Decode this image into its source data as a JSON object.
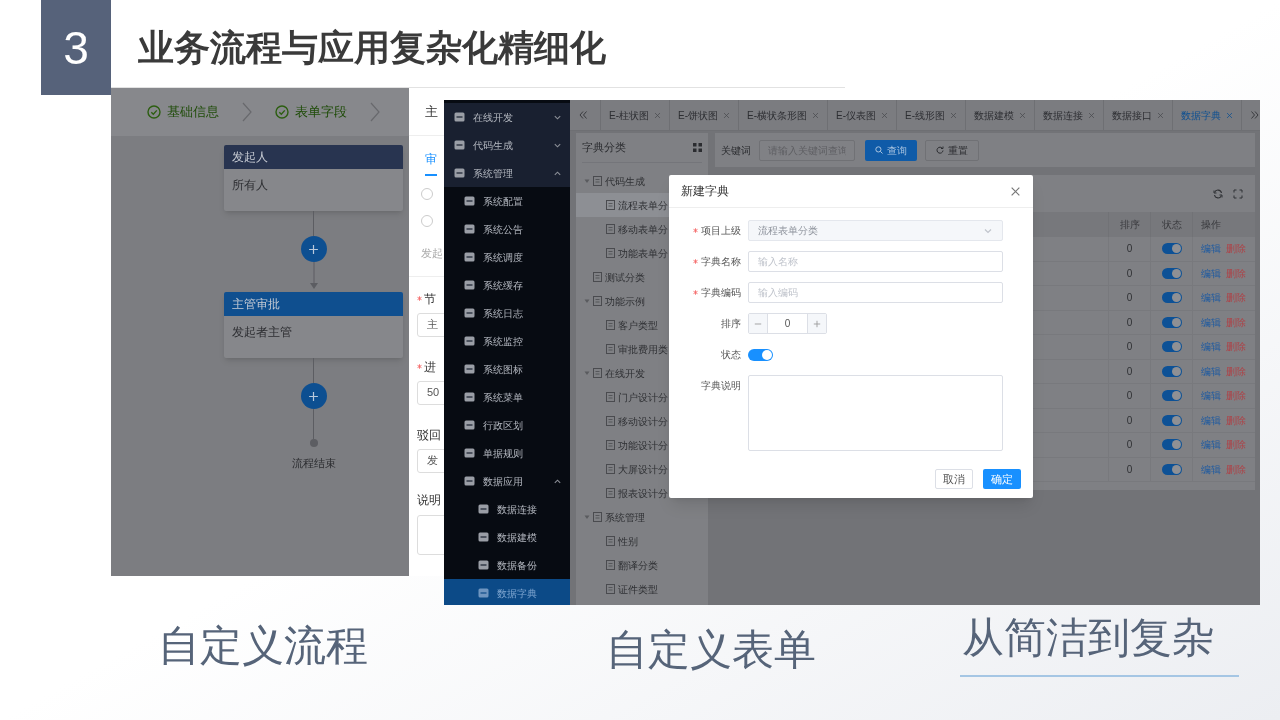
{
  "slide": {
    "number": "3",
    "title": "业务流程与应用复杂化精细化"
  },
  "flow_screenshot": {
    "steps": [
      {
        "label": "基础信息",
        "done": true
      },
      {
        "label": "表单字段",
        "done": true
      }
    ],
    "nodes": [
      {
        "kind": "start",
        "header": "发起人",
        "body": "所有人"
      },
      {
        "kind": "approval",
        "header": "主管审批",
        "body": "发起者主管"
      }
    ],
    "end_label": "流程结束"
  },
  "settings_panel": {
    "header": "主",
    "tab": {
      "label": "审",
      "selected": true
    },
    "radios": [
      {
        "selected": false
      },
      {
        "selected": false
      }
    ],
    "note": "发起",
    "fields": [
      {
        "label": "节",
        "required": true,
        "value": "主"
      },
      {
        "label": "进",
        "required": true,
        "value": "50"
      },
      {
        "label": "驳回",
        "required": false,
        "value": "发"
      }
    ],
    "description_label": "说明"
  },
  "app_screenshot": {
    "sidebar": [
      {
        "label": "在线开发",
        "expanded": false,
        "selected": false
      },
      {
        "label": "代码生成",
        "expanded": false,
        "selected": false
      },
      {
        "label": "系统管理",
        "expanded": true,
        "selected": false,
        "children": [
          {
            "label": "系统配置",
            "selected": false
          },
          {
            "label": "系统公告",
            "selected": false
          },
          {
            "label": "系统调度",
            "selected": false
          },
          {
            "label": "系统缓存",
            "selected": false
          },
          {
            "label": "系统日志",
            "selected": false
          },
          {
            "label": "系统监控",
            "selected": false
          },
          {
            "label": "系统图标",
            "selected": false
          },
          {
            "label": "系统菜单",
            "selected": false
          },
          {
            "label": "行政区划",
            "selected": false
          },
          {
            "label": "单据规则",
            "selected": false
          },
          {
            "label": "数据应用",
            "expanded": true,
            "selected": false,
            "children": [
              {
                "label": "数据连接",
                "selected": false
              },
              {
                "label": "数据建模",
                "selected": false
              },
              {
                "label": "数据备份",
                "selected": false
              },
              {
                "label": "数据字典",
                "selected": true
              }
            ]
          }
        ]
      }
    ],
    "tabs": [
      {
        "label": "E-柱状图",
        "selected": false
      },
      {
        "label": "E-饼状图",
        "selected": false
      },
      {
        "label": "E-横状条形图",
        "selected": false
      },
      {
        "label": "E-仪表图",
        "selected": false
      },
      {
        "label": "E-线形图",
        "selected": false
      },
      {
        "label": "数据建模",
        "selected": false
      },
      {
        "label": "数据连接",
        "selected": false
      },
      {
        "label": "数据接口",
        "selected": false
      },
      {
        "label": "数据字典",
        "selected": true
      }
    ],
    "tree": {
      "title": "字典分类",
      "items": [
        {
          "label": "代码生成",
          "expanded": true,
          "selected": false,
          "children": [
            {
              "label": "流程表单分",
              "selected": true
            },
            {
              "label": "移动表单分",
              "selected": false
            },
            {
              "label": "功能表单分",
              "selected": false
            }
          ]
        },
        {
          "label": "测试分类",
          "selected": false
        },
        {
          "label": "功能示例",
          "expanded": true,
          "selected": false,
          "children": [
            {
              "label": "客户类型",
              "selected": false
            },
            {
              "label": "审批费用类",
              "selected": false
            }
          ]
        },
        {
          "label": "在线开发",
          "expanded": true,
          "selected": false,
          "children": [
            {
              "label": "门户设计分",
              "selected": false
            },
            {
              "label": "移动设计分",
              "selected": false
            },
            {
              "label": "功能设计分",
              "selected": false
            },
            {
              "label": "大屏设计分",
              "selected": false
            },
            {
              "label": "报表设计分",
              "selected": false
            }
          ]
        },
        {
          "label": "系统管理",
          "expanded": true,
          "selected": false,
          "children": [
            {
              "label": "性别",
              "selected": false
            },
            {
              "label": "翻译分类",
              "selected": false
            },
            {
              "label": "证件类型",
              "selected": false
            }
          ]
        }
      ]
    },
    "search": {
      "label": "关键词",
      "placeholder": "请输入关键词查询",
      "buttons": [
        "查询",
        "重置"
      ]
    },
    "table": {
      "columns": [
        "排序",
        "状态",
        "操作"
      ],
      "rows": [
        {
          "sort": "0",
          "enabled": true,
          "actions": [
            "编辑",
            "删除"
          ]
        },
        {
          "sort": "0",
          "enabled": true,
          "actions": [
            "编辑",
            "删除"
          ]
        },
        {
          "sort": "0",
          "enabled": true,
          "actions": [
            "编辑",
            "删除"
          ]
        },
        {
          "sort": "0",
          "enabled": true,
          "actions": [
            "编辑",
            "删除"
          ]
        },
        {
          "sort": "0",
          "enabled": true,
          "actions": [
            "编辑",
            "删除"
          ]
        },
        {
          "sort": "0",
          "enabled": true,
          "actions": [
            "编辑",
            "删除"
          ]
        },
        {
          "sort": "0",
          "enabled": true,
          "actions": [
            "编辑",
            "删除"
          ]
        },
        {
          "sort": "0",
          "enabled": true,
          "actions": [
            "编辑",
            "删除"
          ]
        },
        {
          "sort": "0",
          "enabled": true,
          "actions": [
            "编辑",
            "删除"
          ]
        },
        {
          "sort": "0",
          "enabled": true,
          "actions": [
            "编辑",
            "删除"
          ]
        }
      ]
    },
    "dialog": {
      "title": "新建字典",
      "fields": [
        {
          "kind": "select",
          "label": "项目上级",
          "required": true,
          "value": "流程表单分类"
        },
        {
          "kind": "input",
          "label": "字典名称",
          "required": true,
          "placeholder": "输入名称"
        },
        {
          "kind": "input",
          "label": "字典编码",
          "required": true,
          "placeholder": "输入编码"
        },
        {
          "kind": "number",
          "label": "排序",
          "required": false,
          "value": "0"
        },
        {
          "kind": "switch",
          "label": "状态",
          "required": false,
          "on": true
        },
        {
          "kind": "textarea",
          "label": "字典说明",
          "required": false
        }
      ],
      "buttons": [
        {
          "label": "取消",
          "primary": false
        },
        {
          "label": "确定",
          "primary": true
        }
      ]
    }
  },
  "captions": [
    {
      "text": "自定义流程",
      "underlined": false
    },
    {
      "text": "自定义表单",
      "underlined": false
    },
    {
      "text": "从简洁到复杂",
      "underlined": true
    }
  ]
}
